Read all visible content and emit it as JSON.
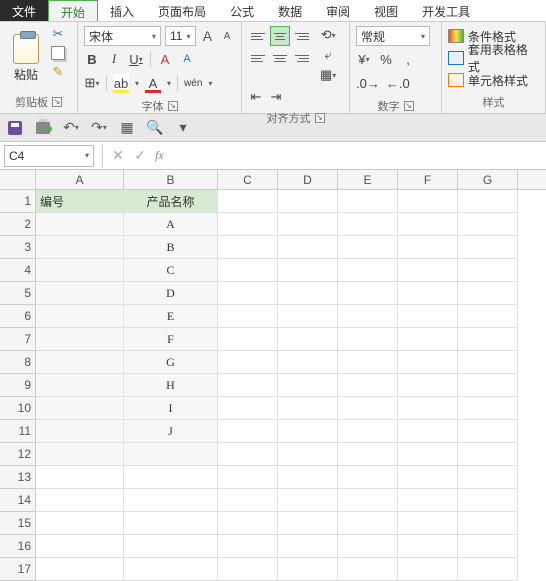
{
  "tabs": {
    "file": "文件",
    "home": "开始",
    "insert": "插入",
    "layout": "页面布局",
    "formula": "公式",
    "data": "数据",
    "review": "审阅",
    "view": "视图",
    "dev": "开发工具"
  },
  "clipboard": {
    "paste": "粘贴",
    "label": "剪贴板"
  },
  "font": {
    "name": "宋体",
    "size": "11",
    "bold": "B",
    "italic": "I",
    "underline": "U",
    "bigA": "A",
    "smallA": "A",
    "clear": "A",
    "border": "⊞",
    "fill": "A",
    "color": "A",
    "phonetic": "wén",
    "label": "字体"
  },
  "align": {
    "label": "对齐方式",
    "wrap": "",
    "merge": "",
    "orient": ""
  },
  "number": {
    "format": "常规",
    "label": "数字",
    "currency": "%",
    "comma": "%",
    "percent": "%",
    "dec_inc": "",
    "dec_dec": ""
  },
  "styles": {
    "cond": "条件格式",
    "table": "套用表格格式",
    "cell": "单元格样式",
    "label": "样式"
  },
  "namebox": "C4",
  "fx": "fx",
  "cols": [
    "A",
    "B",
    "C",
    "D",
    "E",
    "F",
    "G"
  ],
  "sheet": {
    "header": {
      "a": "编号",
      "b": "产品名称"
    },
    "rows": [
      {
        "b": "A"
      },
      {
        "b": "B"
      },
      {
        "b": "C"
      },
      {
        "b": "D"
      },
      {
        "b": "E"
      },
      {
        "b": "F"
      },
      {
        "b": "G"
      },
      {
        "b": "H"
      },
      {
        "b": "I"
      },
      {
        "b": "J"
      }
    ]
  }
}
